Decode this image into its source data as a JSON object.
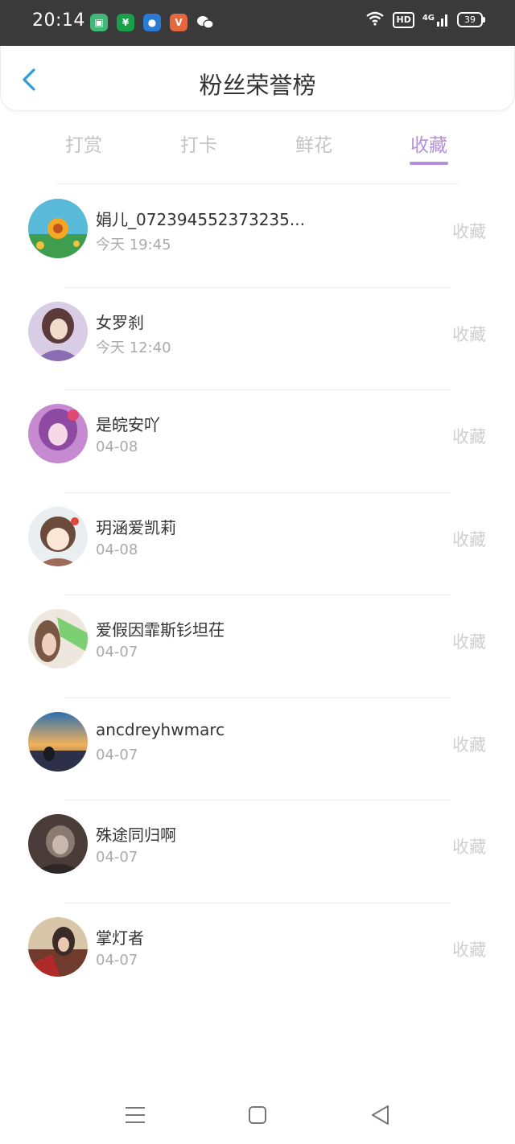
{
  "status_bar": {
    "time": "20:14",
    "apps": [
      {
        "icon": "green-app-icon",
        "glyph": "▣",
        "color": "#3fb878"
      },
      {
        "icon": "green-bag-app-icon",
        "glyph": "¥",
        "color": "#1aa04a"
      },
      {
        "icon": "blue-circle-app-icon",
        "glyph": "●",
        "color": "#2a7bd6"
      },
      {
        "icon": "orange-app-icon",
        "glyph": "V",
        "color": "#e4673f"
      },
      {
        "icon": "wechat-icon",
        "glyph": "",
        "color": "#3a3a3a"
      }
    ],
    "network_label": "HD",
    "signal_label": "4G",
    "battery_level": "39"
  },
  "header": {
    "title": "粉丝荣誉榜",
    "back_icon": "back-chevron-icon"
  },
  "tabs": [
    {
      "label": "打赏",
      "active": false
    },
    {
      "label": "打卡",
      "active": false
    },
    {
      "label": "鲜花",
      "active": false
    },
    {
      "label": "收藏",
      "active": true
    }
  ],
  "accent_color": "#b38fdc",
  "fans": [
    {
      "name": "娟儿_072394552373235...",
      "time": "今天 19:45",
      "type": "收藏",
      "avatar": "sunflower"
    },
    {
      "name": "女罗刹",
      "time": "今天 12:40",
      "type": "收藏",
      "avatar": "anime-purple"
    },
    {
      "name": "是皖安吖",
      "time": "04-08",
      "type": "收藏",
      "avatar": "anime-pink"
    },
    {
      "name": "玥涵爱凯莉",
      "time": "04-08",
      "type": "收藏",
      "avatar": "chibi"
    },
    {
      "name": "爱假因霏斯钐坦茌",
      "time": "04-07",
      "type": "收藏",
      "avatar": "girl-photo"
    },
    {
      "name": "ancdreyhwmarc",
      "time": "04-07",
      "type": "收藏",
      "avatar": "sunset-sea"
    },
    {
      "name": "殊途同归啊",
      "time": "04-07",
      "type": "收藏",
      "avatar": "dark-sketch"
    },
    {
      "name": "掌灯者",
      "time": "04-07",
      "type": "收藏",
      "avatar": "warrior"
    }
  ],
  "nav_bar": {
    "menu_icon": "menu-icon",
    "home_icon": "home-square-icon",
    "back_icon": "back-triangle-icon"
  }
}
